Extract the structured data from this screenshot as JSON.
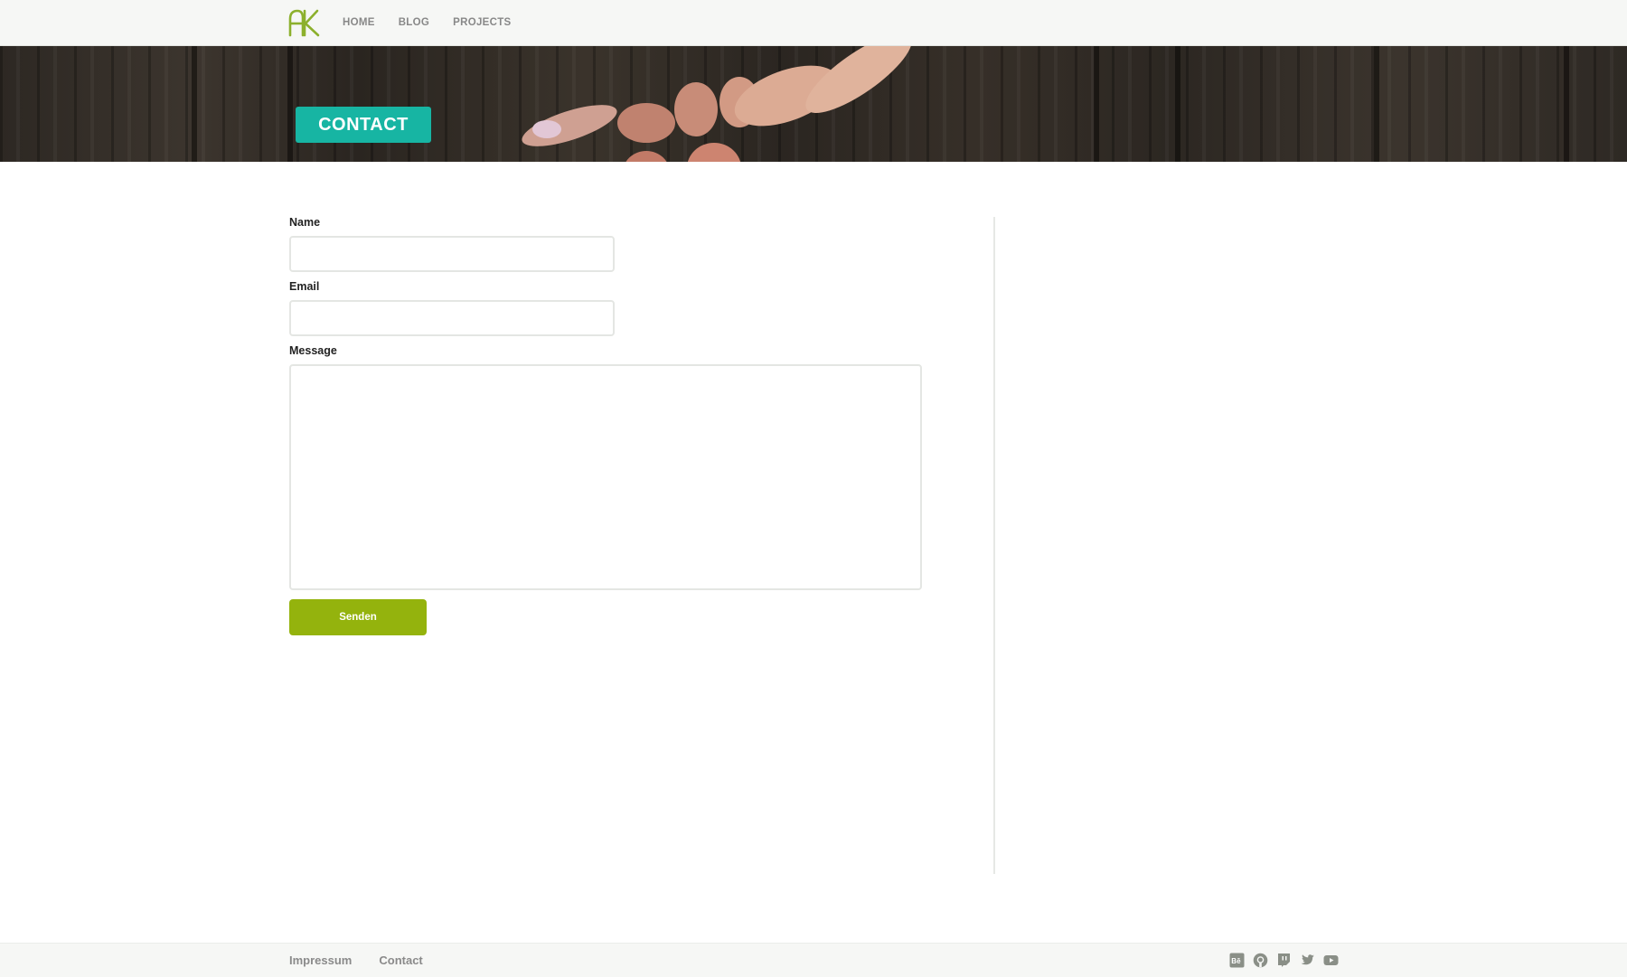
{
  "header": {
    "logo_alt": "AK",
    "nav": [
      "HOME",
      "BLOG",
      "PROJECTS"
    ]
  },
  "hero": {
    "title": "CONTACT"
  },
  "form": {
    "name_label": "Name",
    "name_value": "",
    "email_label": "Email",
    "email_value": "",
    "message_label": "Message",
    "message_value": "",
    "submit_label": "Senden"
  },
  "footer": {
    "links": [
      "Impressum",
      "Contact"
    ],
    "social_icons": [
      "behance-icon",
      "github-icon",
      "twitch-icon",
      "twitter-icon",
      "youtube-icon"
    ]
  },
  "colors": {
    "accent_teal": "#17b5a3",
    "accent_green": "#94b30d",
    "logo_green": "#8cb02c"
  }
}
